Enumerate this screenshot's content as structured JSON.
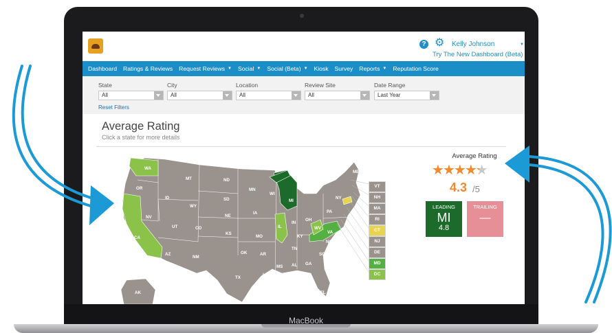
{
  "device": {
    "brand": "MacBook"
  },
  "header": {
    "help_glyph": "?",
    "settings_glyph": "⚙",
    "user_name": "Kelly Johnson",
    "user_caret": "▼",
    "new_dashboard_link": "Try The New Dashboard (Beta)"
  },
  "nav": {
    "items": [
      {
        "label": "Dashboard",
        "dropdown": false
      },
      {
        "label": "Ratings & Reviews",
        "dropdown": false
      },
      {
        "label": "Request Reviews",
        "dropdown": true
      },
      {
        "label": "Social",
        "dropdown": true
      },
      {
        "label": "Social (Beta)",
        "dropdown": true
      },
      {
        "label": "Kiosk",
        "dropdown": false
      },
      {
        "label": "Survey",
        "dropdown": false
      },
      {
        "label": "Reports",
        "dropdown": true
      },
      {
        "label": "Reputation Score",
        "dropdown": false
      }
    ],
    "caret": "▼"
  },
  "filters": {
    "state": {
      "label": "State",
      "value": "All"
    },
    "city": {
      "label": "City",
      "value": "All"
    },
    "location": {
      "label": "Location",
      "value": "All"
    },
    "review_site": {
      "label": "Review Site",
      "value": "All"
    },
    "date_range": {
      "label": "Date Range",
      "value": "Last Year"
    },
    "reset_label": "Reset Filters"
  },
  "page": {
    "title": "Average Rating",
    "subtitle": "Click a state for more details"
  },
  "map": {
    "colors": {
      "neutral": "#9a928d",
      "light_green": "#8bc34a",
      "dark_green": "#1c6b2a",
      "mid_green": "#55b043",
      "yellow": "#e8d44d"
    },
    "state_labels": [
      "WA",
      "OR",
      "CA",
      "NV",
      "ID",
      "MT",
      "WY",
      "UT",
      "AZ",
      "CO",
      "NM",
      "ND",
      "SD",
      "NE",
      "KS",
      "OK",
      "TX",
      "MN",
      "IA",
      "MO",
      "AR",
      "LA",
      "WI",
      "IL",
      "MI",
      "IN",
      "OH",
      "KY",
      "TN",
      "MS",
      "AL",
      "GA",
      "FL",
      "SC",
      "NC",
      "VA",
      "WV",
      "PA",
      "NY",
      "ME",
      "AK"
    ],
    "northeast_boxes": [
      {
        "label": "VT",
        "color": "#9a928d"
      },
      {
        "label": "NH",
        "color": "#9a928d"
      },
      {
        "label": "MA",
        "color": "#9a928d"
      },
      {
        "label": "RI",
        "color": "#9a928d"
      },
      {
        "label": "CT",
        "color": "#e8d44d"
      },
      {
        "label": "NJ",
        "color": "#9a928d"
      },
      {
        "label": "DE",
        "color": "#9a928d"
      },
      {
        "label": "MD",
        "color": "#55b043"
      },
      {
        "label": "DC",
        "color": "#8bc34a"
      }
    ]
  },
  "summary": {
    "label": "Average Rating",
    "rating": 4.3,
    "rating_text": "4.3",
    "max_text": "/5",
    "star_glyph": "★",
    "leading": {
      "title": "LEADING",
      "state": "MI",
      "value": "4.8"
    },
    "trailing": {
      "title": "TRAILING",
      "state": "—"
    }
  },
  "colors": {
    "accent": "#1c8ec7",
    "arrow": "#1b9ad6",
    "rating_orange": "#ef8a2c"
  }
}
